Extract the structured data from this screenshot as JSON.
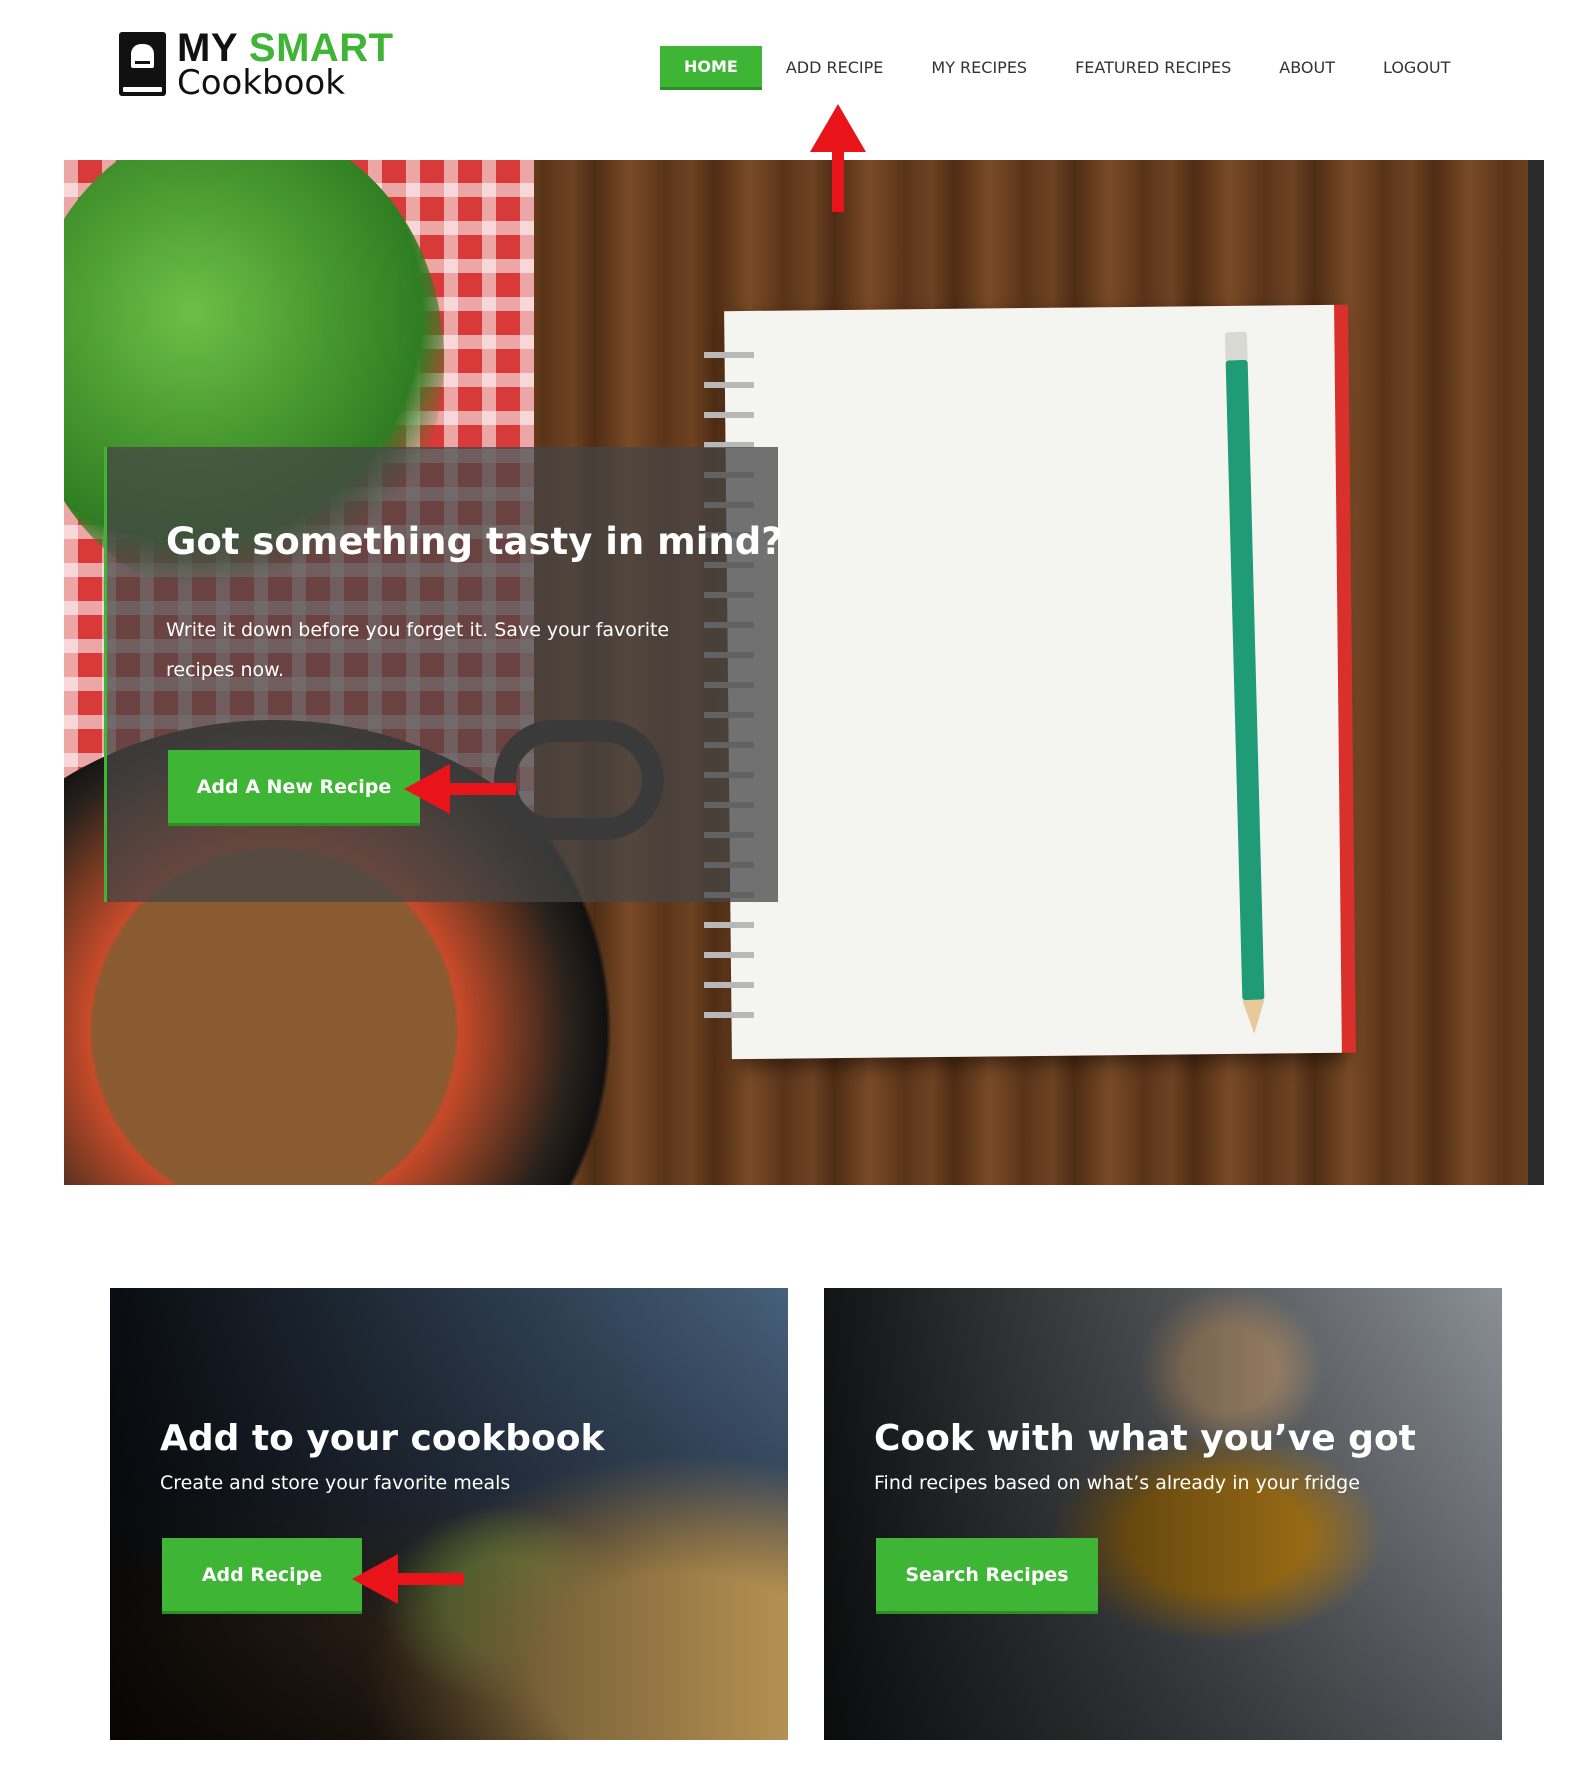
{
  "logo": {
    "line1_my": "MY",
    "line1_smart": "SMART",
    "line2": "Cookbook"
  },
  "nav": {
    "items": [
      {
        "label": "HOME",
        "active": true
      },
      {
        "label": "ADD RECIPE",
        "active": false
      },
      {
        "label": "MY RECIPES",
        "active": false
      },
      {
        "label": "FEATURED RECIPES",
        "active": false
      },
      {
        "label": "ABOUT",
        "active": false
      },
      {
        "label": "LOGOUT",
        "active": false
      }
    ]
  },
  "hero": {
    "title": "Got something tasty in mind?",
    "subtitle": "Write it down before you forget it. Save your favorite recipes now.",
    "button_label": "Add A New Recipe"
  },
  "cards": [
    {
      "title": "Add to your cookbook",
      "subtitle": "Create and store your favorite meals",
      "button_label": "Add Recipe"
    },
    {
      "title": "Cook with what you’ve got",
      "subtitle": "Find recipes based on what’s already in your fridge",
      "button_label": "Search Recipes"
    }
  ],
  "colors": {
    "brand_green": "#3fb536",
    "annotation_red": "#e8141a"
  },
  "annotations": [
    "arrow-up-icon",
    "arrow-left-icon",
    "arrow-left-icon"
  ]
}
